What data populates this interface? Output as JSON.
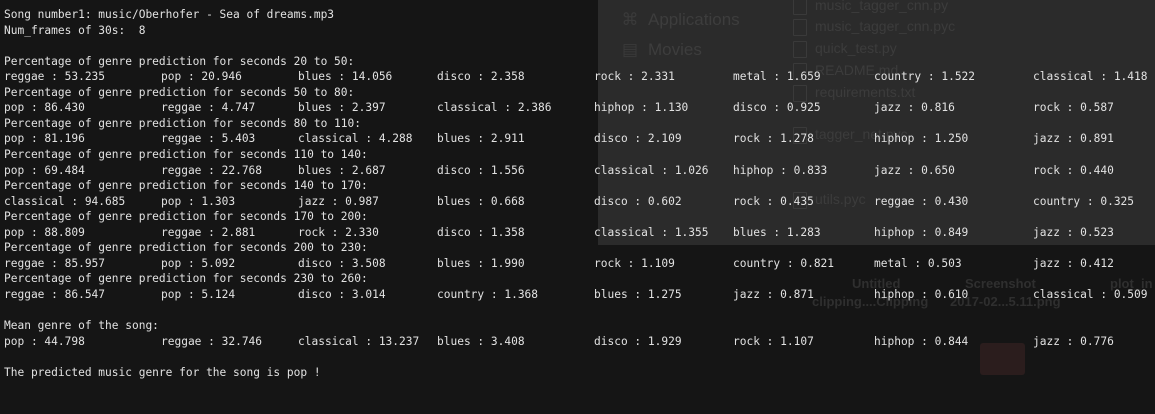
{
  "background_finder": {
    "sidebar": [
      {
        "icon": "applications-icon",
        "glyph": "⌘",
        "label": "Applications"
      },
      {
        "icon": "movies-icon",
        "glyph": "▤",
        "label": "Movies"
      }
    ],
    "files": [
      "music_tagger_cnn.py",
      "music_tagger_cnn.pyc",
      "quick_test.py",
      "README.md",
      "requirements.txt",
      "tagger_net.pyc",
      "utils.pyc"
    ],
    "desktop_labels": [
      "Untitled",
      "Screenshot",
      "plot_in",
      "clipping....Clipping",
      "2017-02...5.11.png"
    ]
  },
  "terminal": {
    "lines": [
      {
        "segments": [
          "Song number1: music/Oberhofer - Sea of dreams.mp3"
        ]
      },
      {
        "segments": [
          "Num_frames of 30s:  8"
        ]
      },
      {
        "segments": []
      },
      {
        "segments": [
          "Percentage of genre prediction for seconds 20 to 50:"
        ]
      },
      {
        "segments": [
          "reggae : 53.235",
          "pop : 20.946",
          "blues : 14.056",
          "disco : 2.358",
          "rock : 2.331",
          "metal : 1.659",
          "country : 1.522",
          "classical : 1.418"
        ]
      },
      {
        "segments": [
          "Percentage of genre prediction for seconds 50 to 80:"
        ]
      },
      {
        "segments": [
          "pop : 86.430",
          "reggae : 4.747",
          "blues : 2.397",
          "classical : 2.386",
          "hiphop : 1.130",
          "disco : 0.925",
          "jazz : 0.816",
          "rock : 0.587"
        ]
      },
      {
        "segments": [
          "Percentage of genre prediction for seconds 80 to 110:"
        ]
      },
      {
        "segments": [
          "pop : 81.196",
          "reggae : 5.403",
          "classical : 4.288",
          "blues : 2.911",
          "disco : 2.109",
          "rock : 1.278",
          "hiphop : 1.250",
          "jazz : 0.891"
        ]
      },
      {
        "segments": [
          "Percentage of genre prediction for seconds 110 to 140:"
        ]
      },
      {
        "segments": [
          "pop : 69.484",
          "reggae : 22.768",
          "blues : 2.687",
          "disco : 1.556",
          "classical : 1.026",
          "hiphop : 0.833",
          "jazz : 0.650",
          "rock : 0.440"
        ]
      },
      {
        "segments": [
          "Percentage of genre prediction for seconds 140 to 170:"
        ]
      },
      {
        "segments": [
          "classical : 94.685",
          "pop : 1.303",
          "jazz : 0.987",
          "blues : 0.668",
          "disco : 0.602",
          "rock : 0.435",
          "reggae : 0.430",
          "country : 0.325"
        ]
      },
      {
        "segments": [
          "Percentage of genre prediction for seconds 170 to 200:"
        ]
      },
      {
        "segments": [
          "pop : 88.809",
          "reggae : 2.881",
          "rock : 2.330",
          "disco : 1.358",
          "classical : 1.355",
          "blues : 1.283",
          "hiphop : 0.849",
          "jazz : 0.523"
        ]
      },
      {
        "segments": [
          "Percentage of genre prediction for seconds 200 to 230:"
        ]
      },
      {
        "segments": [
          "reggae : 85.957",
          "pop : 5.092",
          "disco : 3.508",
          "blues : 1.990",
          "rock : 1.109",
          "country : 0.821",
          "metal : 0.503",
          "jazz : 0.412"
        ]
      },
      {
        "segments": [
          "Percentage of genre prediction for seconds 230 to 260:"
        ]
      },
      {
        "segments": [
          "reggae : 86.547",
          "pop : 5.124",
          "disco : 3.014",
          "country : 1.368",
          "blues : 1.275",
          "jazz : 0.871",
          "hiphop : 0.610",
          "classical : 0.509"
        ]
      },
      {
        "segments": []
      },
      {
        "segments": [
          "Mean genre of the song:"
        ]
      },
      {
        "segments": [
          "pop : 44.798",
          "reggae : 32.746",
          "classical : 13.237",
          "blues : 3.408",
          "disco : 1.929",
          "rock : 1.107",
          "hiphop : 0.844",
          "jazz : 0.776"
        ]
      },
      {
        "segments": []
      },
      {
        "segments": [
          "The predicted music genre for the song is pop !"
        ]
      }
    ]
  },
  "colors": {
    "terminal_text": "#e2e2e2",
    "terminal_bg": "#151515"
  }
}
